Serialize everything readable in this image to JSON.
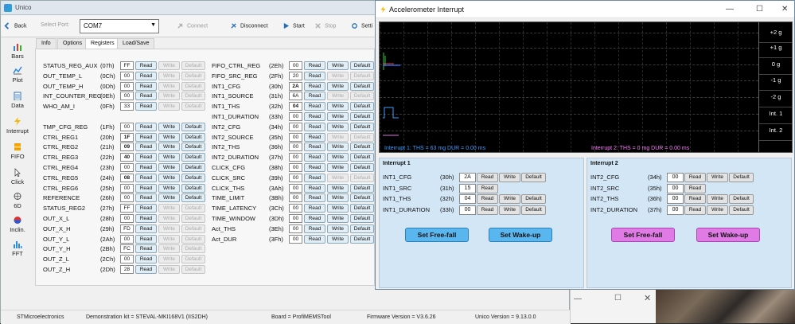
{
  "unico": {
    "title": "Unico",
    "toolbar": {
      "back": "Back",
      "select_port_label": "Select Port:",
      "port_value": "COM7",
      "connect": "Connect",
      "disconnect": "Disconnect",
      "start": "Start",
      "stop": "Stop",
      "settings_partial": "Setti"
    },
    "sidebar": [
      "Bars",
      "Plot",
      "Data",
      "Interrupt",
      "FIFO",
      "Click",
      "6D",
      "Inclin.",
      "FFT"
    ],
    "tabs": [
      "Info",
      "Options",
      "Registers",
      "Load/Save"
    ],
    "buttons": {
      "read": "Read",
      "write": "Write",
      "default": "Default"
    },
    "registers_left": [
      {
        "name": "STATUS_REG_AUX",
        "addr": "(07h)",
        "value": "FF",
        "bold": false,
        "writable": false
      },
      {
        "name": "OUT_TEMP_L",
        "addr": "(0Ch)",
        "value": "00",
        "bold": false,
        "writable": false
      },
      {
        "name": "OUT_TEMP_H",
        "addr": "(0Dh)",
        "value": "00",
        "bold": false,
        "writable": false
      },
      {
        "name": "INT_COUNTER_REG",
        "addr": "(0Eh)",
        "value": "00",
        "bold": false,
        "writable": false
      },
      {
        "name": "WHO_AM_I",
        "addr": "(0Fh)",
        "value": "33",
        "bold": false,
        "writable": false
      },
      {
        "name": "TMP_CFG_REG",
        "addr": "(1Fh)",
        "value": "00",
        "bold": false,
        "writable": true
      },
      {
        "name": "CTRL_REG1",
        "addr": "(20h)",
        "value": "1F",
        "bold": true,
        "writable": true
      },
      {
        "name": "CTRL_REG2",
        "addr": "(21h)",
        "value": "09",
        "bold": true,
        "writable": true
      },
      {
        "name": "CTRL_REG3",
        "addr": "(22h)",
        "value": "40",
        "bold": true,
        "writable": true
      },
      {
        "name": "CTRL_REG4",
        "addr": "(23h)",
        "value": "00",
        "bold": false,
        "writable": true
      },
      {
        "name": "CTRL_REG5",
        "addr": "(24h)",
        "value": "08",
        "bold": true,
        "writable": true
      },
      {
        "name": "CTRL_REG6",
        "addr": "(25h)",
        "value": "00",
        "bold": false,
        "writable": true
      },
      {
        "name": "REFERENCE",
        "addr": "(26h)",
        "value": "00",
        "bold": false,
        "writable": true
      },
      {
        "name": "STATUS_REG2",
        "addr": "(27h)",
        "value": "FF",
        "bold": false,
        "writable": false
      },
      {
        "name": "OUT_X_L",
        "addr": "(28h)",
        "value": "00",
        "bold": false,
        "writable": false
      },
      {
        "name": "OUT_X_H",
        "addr": "(29h)",
        "value": "FD",
        "bold": false,
        "writable": false
      },
      {
        "name": "OUT_Y_L",
        "addr": "(2Ah)",
        "value": "00",
        "bold": false,
        "writable": false
      },
      {
        "name": "OUT_Y_H",
        "addr": "(2Bh)",
        "value": "FC",
        "bold": false,
        "writable": false
      },
      {
        "name": "OUT_Z_L",
        "addr": "(2Ch)",
        "value": "00",
        "bold": false,
        "writable": false
      },
      {
        "name": "OUT_Z_H",
        "addr": "(2Dh)",
        "value": "28",
        "bold": false,
        "writable": false
      }
    ],
    "registers_right": [
      {
        "name": "FIFO_CTRL_REG",
        "addr": "(2Eh)",
        "value": "00",
        "bold": false,
        "writable": true
      },
      {
        "name": "FIFO_SRC_REG",
        "addr": "(2Fh)",
        "value": "20",
        "bold": false,
        "writable": false
      },
      {
        "name": "INT1_CFG",
        "addr": "(30h)",
        "value": "2A",
        "bold": true,
        "writable": true
      },
      {
        "name": "INT1_SOURCE",
        "addr": "(31h)",
        "value": "6A",
        "bold": false,
        "writable": false
      },
      {
        "name": "INT1_THS",
        "addr": "(32h)",
        "value": "04",
        "bold": true,
        "writable": true
      },
      {
        "name": "INT1_DURATION",
        "addr": "(33h)",
        "value": "00",
        "bold": false,
        "writable": true
      },
      {
        "name": "INT2_CFG",
        "addr": "(34h)",
        "value": "00",
        "bold": false,
        "writable": true
      },
      {
        "name": "INT2_SOURCE",
        "addr": "(35h)",
        "value": "00",
        "bold": false,
        "writable": false
      },
      {
        "name": "INT2_THS",
        "addr": "(36h)",
        "value": "00",
        "bold": false,
        "writable": true
      },
      {
        "name": "INT2_DURATION",
        "addr": "(37h)",
        "value": "00",
        "bold": false,
        "writable": true
      },
      {
        "name": "CLICK_CFG",
        "addr": "(38h)",
        "value": "00",
        "bold": false,
        "writable": true
      },
      {
        "name": "CLICK_SRC",
        "addr": "(39h)",
        "value": "00",
        "bold": false,
        "writable": false
      },
      {
        "name": "CLICK_THS",
        "addr": "(3Ah)",
        "value": "00",
        "bold": false,
        "writable": true
      },
      {
        "name": "TIME_LIMIT",
        "addr": "(3Bh)",
        "value": "00",
        "bold": false,
        "writable": true
      },
      {
        "name": "TIME_LATENCY",
        "addr": "(3Ch)",
        "value": "00",
        "bold": false,
        "writable": true
      },
      {
        "name": "TIME_WINDOW",
        "addr": "(3Dh)",
        "value": "00",
        "bold": false,
        "writable": true
      },
      {
        "name": "Act_THS",
        "addr": "(3Eh)",
        "value": "00",
        "bold": false,
        "writable": true
      },
      {
        "name": "Act_DUR",
        "addr": "(3Fh)",
        "value": "00",
        "bold": false,
        "writable": true
      }
    ],
    "status": {
      "company": "STMicroelectronics",
      "kit": "Demonstration kit = STEVAL-MKI168V1 (IIS2DH)",
      "board": "Board = ProfiMEMSTool",
      "firmware": "Firmware Version = V3.6.26",
      "unico_version": "Unico Version = 9.13.0.0"
    }
  },
  "accel": {
    "title": "Accelerometer Interrupt",
    "plot": {
      "y_labels": [
        "+2 g",
        "+1 g",
        "0 g",
        "-1 g",
        "-2 g",
        "Int. 1",
        "Int. 2"
      ],
      "caption1": "Interrupt 1: THS = 63 mg  DUR = 0.00 ms",
      "caption2": "Interrupt 2: THS = 0 mg  DUR = 0.00 ms",
      "caption1_color": "#3aa0ff",
      "caption2_color": "#ff7cff"
    },
    "int1": {
      "title": "Interrupt 1",
      "rows": [
        {
          "name": "INT1_CFG",
          "addr": "(30h)",
          "value": "2A",
          "writable": true
        },
        {
          "name": "INT1_SRC",
          "addr": "(31h)",
          "value": "15",
          "writable": false
        },
        {
          "name": "INT1_THS",
          "addr": "(32h)",
          "value": "04",
          "writable": true
        },
        {
          "name": "INT1_DURATION",
          "addr": "(33h)",
          "value": "00",
          "writable": true
        }
      ],
      "free_fall": "Set Free-fall",
      "wake_up": "Set Wake-up"
    },
    "int2": {
      "title": "Interrupt 2",
      "rows": [
        {
          "name": "INT2_CFG",
          "addr": "(34h)",
          "value": "00",
          "writable": true
        },
        {
          "name": "INT2_SRC",
          "addr": "(35h)",
          "value": "00",
          "writable": false
        },
        {
          "name": "INT2_THS",
          "addr": "(36h)",
          "value": "00",
          "writable": true
        },
        {
          "name": "INT2_DURATION",
          "addr": "(37h)",
          "value": "00",
          "writable": true
        }
      ],
      "free_fall": "Set Free-fall",
      "wake_up": "Set Wake-up"
    }
  }
}
